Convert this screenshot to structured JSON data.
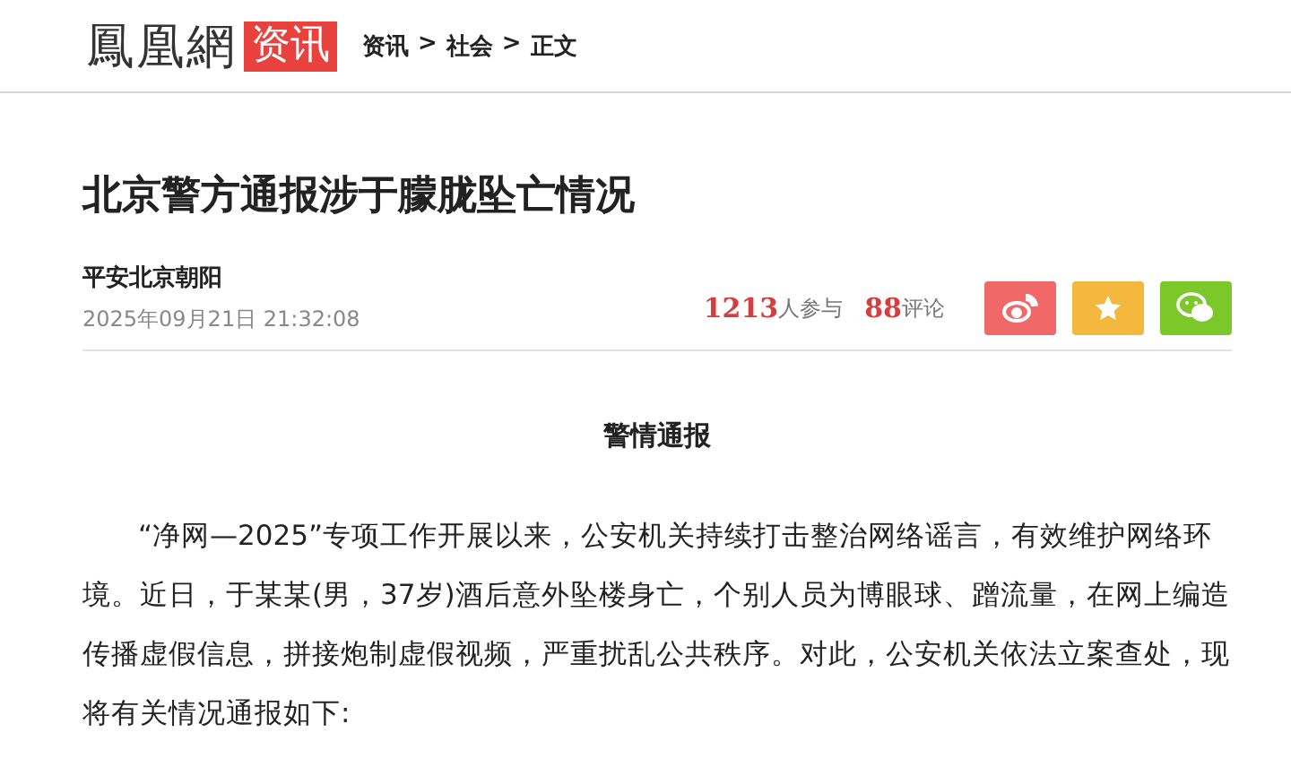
{
  "header": {
    "logo": "鳳凰網",
    "channel": "资讯",
    "breadcrumb": [
      {
        "label": "资讯"
      },
      {
        "label": "社会"
      },
      {
        "label": "正文"
      }
    ],
    "separators": [
      ">",
      ">"
    ]
  },
  "article": {
    "title": "北京警方通报涉于朦胧坠亡情况",
    "author": "平安北京朝阳",
    "date": "2025年09月21日 21:32:08",
    "participants": "1213",
    "participants_label": "人参与",
    "comments": "88",
    "comments_label": "评论",
    "share": [
      {
        "kind": "weibo",
        "color": "#f06868"
      },
      {
        "kind": "favorite",
        "color": "#f5b83f"
      },
      {
        "kind": "wechat",
        "color": "#7cc82a"
      }
    ],
    "heading": "警情通报",
    "paragraphs": [
      "“净网—2025”专项工作开展以来，公安机关持续打击整治网络谣言，有效维护网络环境。近日，于某某(男，37岁)酒后意外坠楼身亡，个别人员为博眼球、蹭流量，在网上编造传播虚假信息，拼接炮制虚假视频，严重扰乱公共秩序。对此，公安机关依法立案查处，现将有关情况通报如下:"
    ]
  }
}
